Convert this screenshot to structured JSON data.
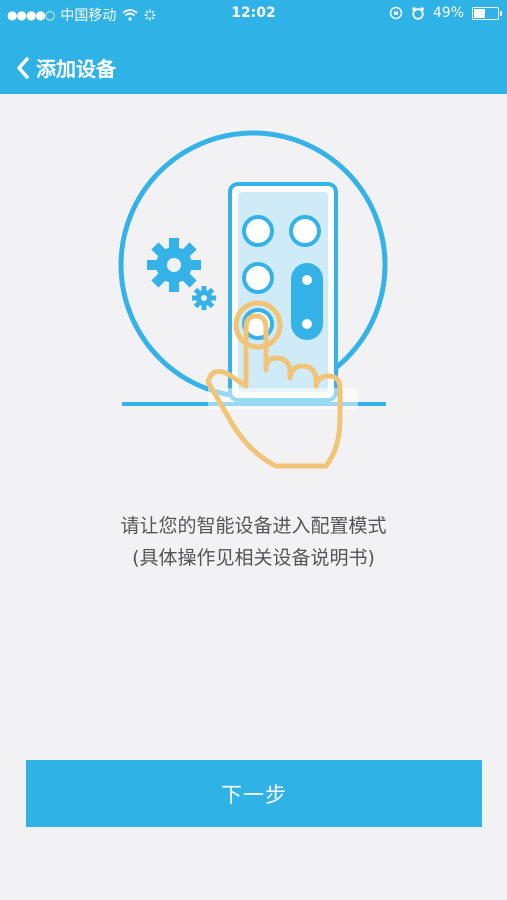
{
  "status": {
    "carrier": "中国移动",
    "time": "12:02",
    "battery_text": "49%",
    "battery_level": 0.49
  },
  "nav": {
    "back_icon": "chevron-left-icon",
    "title": "添加设备"
  },
  "instruction": {
    "line1": "请让您的智能设备进入配置模式",
    "line2": "(具体操作见相关设备说明书)"
  },
  "next_button": {
    "label": "下一步"
  },
  "colors": {
    "primary": "#2fb2e6",
    "background": "#f2f2f4",
    "hand": "#f2c477",
    "text": "#555555"
  }
}
